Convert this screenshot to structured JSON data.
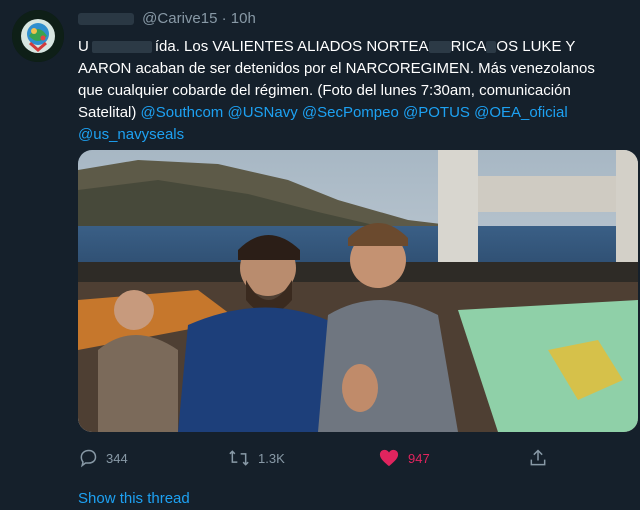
{
  "header": {
    "handle": "@Carive15",
    "separator": "·",
    "time": "10h"
  },
  "tweet": {
    "line1_tail": "ída. Los VALIENTES ALIADOS NORTEA",
    "line1_tail2": "RICA",
    "line1_tail3": "OS LUKE Y",
    "line2": "AARON acaban de ser detenidos por el NARCOREGIMEN. Más venezolanos",
    "line3": "que cualquier cobarde del régimen. (Foto del lunes 7:30am, comunicación",
    "line4_text": "Satelital)",
    "mentions": [
      "@Southcom",
      "@USNavy",
      "@SecPompeo",
      "@POTUS",
      "@OEA_oficial",
      "@us_navyseals"
    ]
  },
  "actions": {
    "replies": "344",
    "retweets": "1.3K",
    "likes": "947",
    "like_color": "#e0245e"
  },
  "footer": {
    "show_thread": "Show this thread"
  },
  "icons": {
    "reply": "reply-icon",
    "retweet": "retweet-icon",
    "like": "heart-icon",
    "share": "share-icon"
  }
}
